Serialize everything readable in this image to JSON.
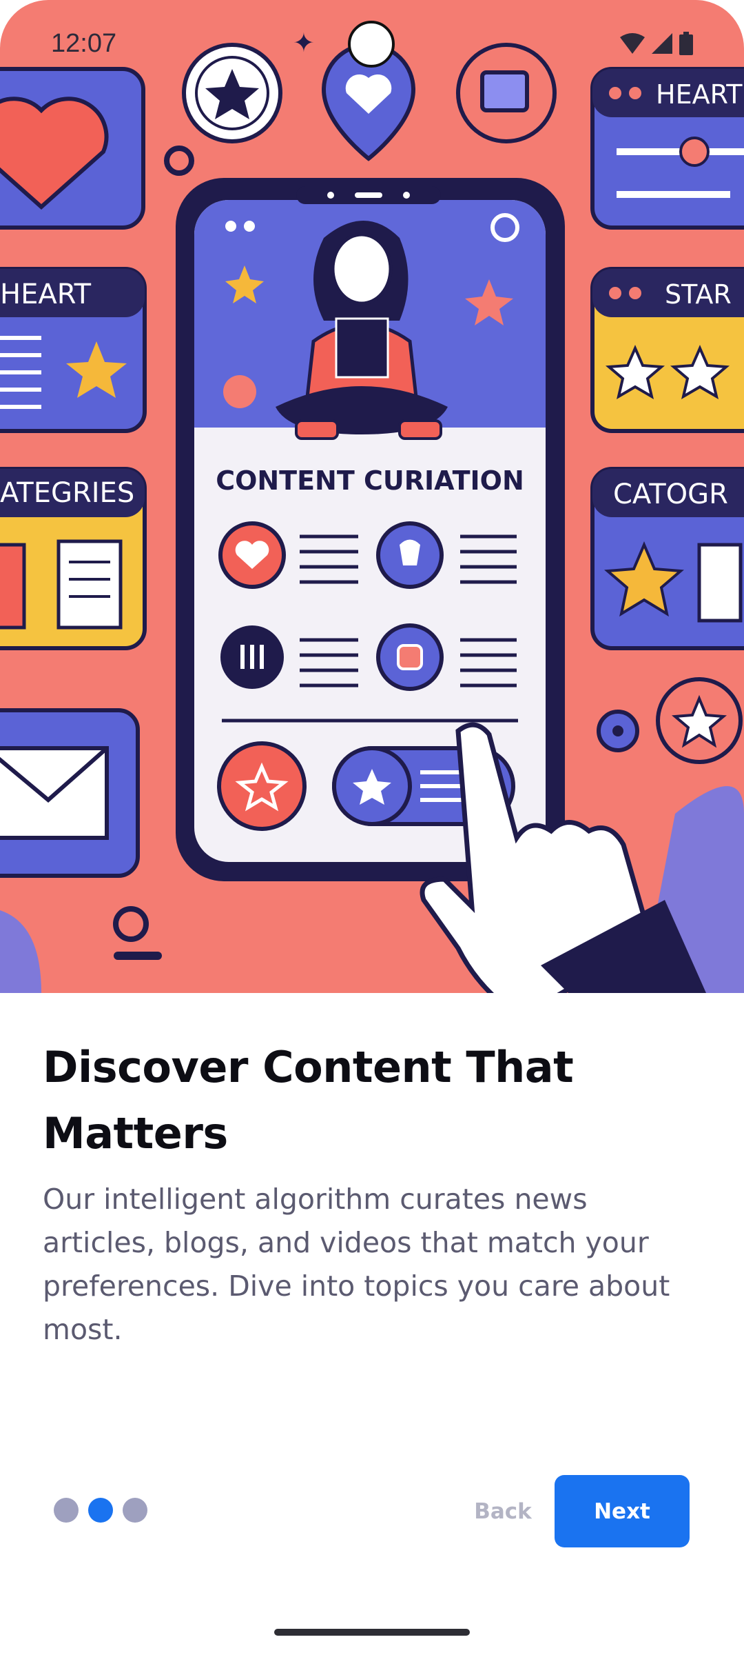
{
  "status_bar": {
    "time": "12:07",
    "icons": [
      "wifi-icon",
      "signal-icon",
      "battery-icon"
    ]
  },
  "hero": {
    "heading": "CONTENT CURIATION",
    "card_labels": {
      "heart_top_right": "HEART",
      "heart_left": "HEART",
      "star_right": "STAR",
      "categories_left": "ATEGRIES",
      "categories_right": "CATOGR"
    },
    "background_color": "#f47c72",
    "accent_color": "#5b63d6",
    "dark_color": "#1f1b4b"
  },
  "onboarding": {
    "title": "Discover Content That Matters",
    "description": "Our intelligent algorithm curates news articles, blogs, and videos that match your preferences. Dive into topics you care about most.",
    "pager": {
      "total": 3,
      "active_index": 1
    },
    "back_label": "Back",
    "next_label": "Next"
  },
  "colors": {
    "primary": "#1a73f0",
    "title": "#0d0d14",
    "body": "#5b5a70",
    "dot_inactive": "#9ea0bf",
    "back_text": "#b3b4c4"
  }
}
